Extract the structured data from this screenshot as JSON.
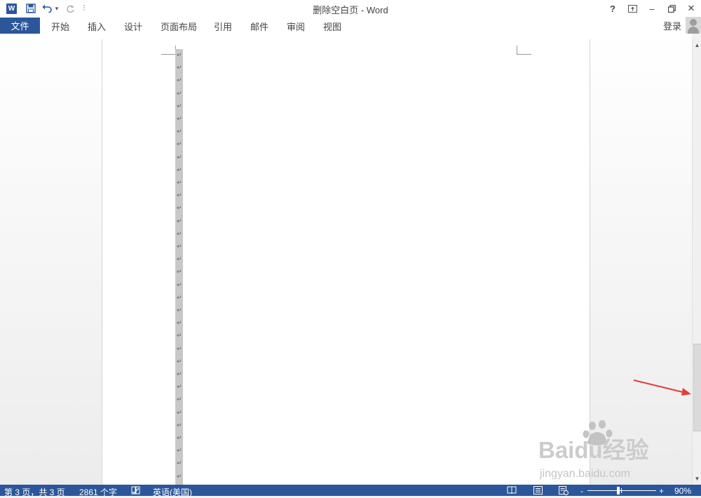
{
  "window": {
    "title": "删除空白页 - Word",
    "help": "?",
    "minimize": "–",
    "close": "✕"
  },
  "qat": {
    "app_logo": "W",
    "undo_dropdown": "▾",
    "customize": "⫶"
  },
  "ribbon": {
    "file": "文件",
    "tabs": [
      "开始",
      "插入",
      "设计",
      "页面布局",
      "引用",
      "邮件",
      "审阅",
      "视图"
    ],
    "login": "登录"
  },
  "document": {
    "paragraph_mark": "↵",
    "paragraph_count": 34
  },
  "scrollbar": {
    "up": "▲",
    "down": "▼"
  },
  "status": {
    "page": "第 3 页，共 3 页",
    "words": "2861 个字",
    "language": "英语(美国)",
    "zoom_minus": "-",
    "zoom_plus": "+",
    "zoom": "90%"
  },
  "watermark": {
    "brand": "Baidu经验",
    "url": "jingyan.baidu.com"
  },
  "colors": {
    "accent": "#2b579a",
    "arrow": "#e0403a"
  },
  "icons": {
    "save": "save-icon",
    "undo": "undo-icon",
    "redo": "redo-icon",
    "ribbon_display": "ribbon-display-icon",
    "restore": "restore-icon",
    "proofing": "proofing-icon",
    "read_mode": "read-mode-icon",
    "print_layout": "print-layout-icon",
    "web_layout": "web-layout-icon"
  }
}
